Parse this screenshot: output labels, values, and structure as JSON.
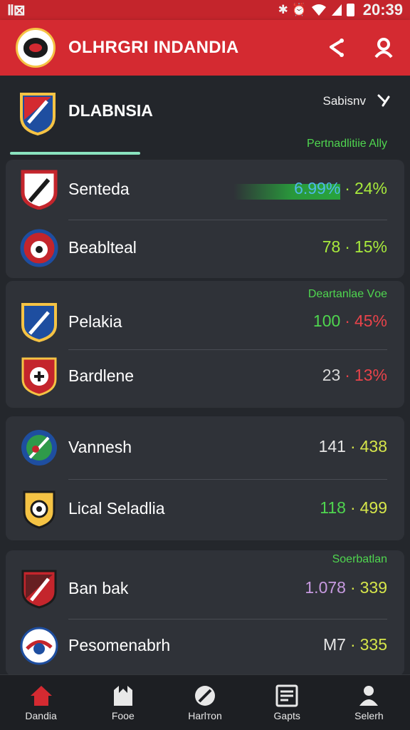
{
  "status_bar": {
    "sim": "Ⅱ⊠",
    "icons": "✱ ⏰",
    "time": "20:39"
  },
  "app_bar": {
    "title": "OLHRGRI INDANDIA"
  },
  "header": {
    "league_name": "DLABNSIA",
    "season_label": "Sabisnv",
    "sub_link": "Pertnadlitiie Ally"
  },
  "cards": [
    {
      "label": "",
      "rows": [
        {
          "name": "Sentedа",
          "value": "6.99%",
          "sep": "·",
          "delta": "24%",
          "value_color": "#4fb8e8",
          "delta_color": "#a8ea3c",
          "has_bar": true
        },
        {
          "name": "Beabltеal",
          "value": "78",
          "sep": "·",
          "delta": "15%",
          "value_color": "#a8ea3c",
          "delta_color": "#a8ea3c",
          "has_bar": false
        }
      ]
    },
    {
      "label": "Deartanlaе Vоe",
      "rows": [
        {
          "name": "Pelakia",
          "value": "100",
          "sep": "·",
          "delta": "45%",
          "value_color": "#4fd64f",
          "delta_color": "#e8434a",
          "has_bar": false
        },
        {
          "name": "Bardlene",
          "value": "23",
          "sep": "·",
          "delta": "13%",
          "value_color": "#d8d8d8",
          "delta_color": "#e8434a",
          "has_bar": false
        }
      ]
    },
    {
      "label": "",
      "rows": [
        {
          "name": "Vannesh",
          "value": "141",
          "sep": "·",
          "delta": "438",
          "value_color": "#e6e6e6",
          "delta_color": "#d6e64a",
          "has_bar": false
        },
        {
          "name": "Lical Seladlia",
          "value": "118",
          "sep": "·",
          "delta": "499",
          "value_color": "#4fd64f",
          "delta_color": "#d6e64a",
          "has_bar": false
        }
      ]
    },
    {
      "label": "Soerbatlan",
      "rows": [
        {
          "name": "Ban bak",
          "value": "1.078",
          "sep": "·",
          "delta": "339",
          "value_color": "#c79ae0",
          "delta_color": "#d6e64a",
          "has_bar": false
        },
        {
          "name": "Pesomenabrh",
          "value": "M7",
          "sep": "·",
          "delta": "335",
          "value_color": "#e6e6e6",
          "delta_color": "#d6e64a",
          "has_bar": false
        }
      ]
    }
  ],
  "bottom_nav": [
    {
      "label": "Dandia",
      "icon": "home-icon",
      "active": true
    },
    {
      "label": "Fooe",
      "icon": "stadium-icon",
      "active": false
    },
    {
      "label": "Harlтоn",
      "icon": "ball-icon",
      "active": false
    },
    {
      "label": "Gapts",
      "icon": "scoreboard-icon",
      "active": false
    },
    {
      "label": "Selerh",
      "icon": "profile-icon",
      "active": false
    }
  ],
  "colors": {
    "accent_red": "#d42a31",
    "background": "#24272c",
    "card": "#2f3238",
    "green": "#4fd64f"
  }
}
